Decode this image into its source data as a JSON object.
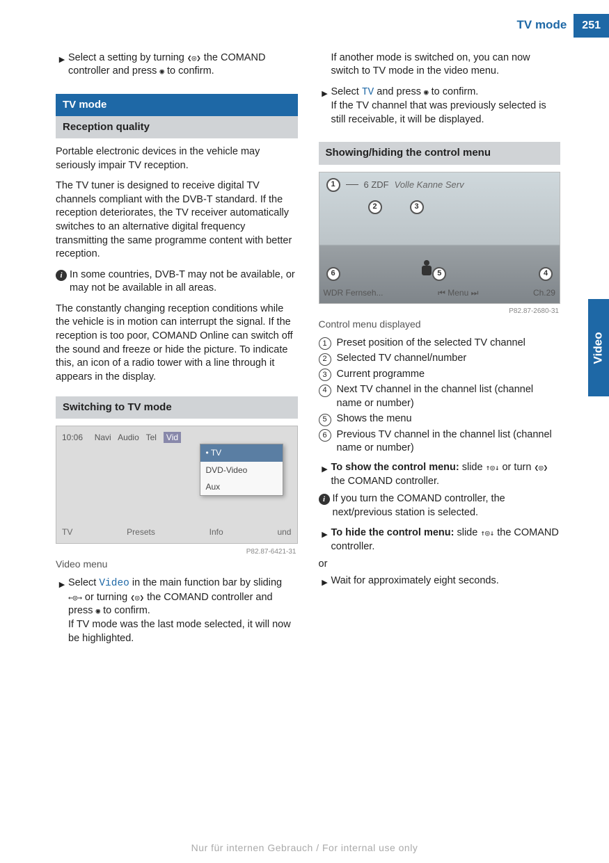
{
  "header": {
    "section": "TV mode",
    "page": "251"
  },
  "sideTab": "Video",
  "watermark": "Nur für internen Gebrauch / For internal use only",
  "left": {
    "topStep": {
      "prefix": "Select a setting by turning ",
      "icon": "❮◎❯",
      "mid": " the COMAND controller and press ",
      "press": "◉",
      "suffix": " to confirm."
    },
    "sectionTitle": "TV mode",
    "sub1": "Reception quality",
    "p1": "Portable electronic devices in the vehicle may seriously impair TV reception.",
    "p2": "The TV tuner is designed to receive digital TV channels compliant with the DVB-T standard. If the reception deteriorates, the TV receiver automatically switches to an alternative digital frequency transmitting the same programme content with better reception.",
    "info1": "In some countries, DVB-T may not be available, or may not be available in all areas.",
    "p3": "The constantly changing reception conditions while the vehicle is in motion can interrupt the signal. If the reception is too poor, COMAND Online can switch off the sound and freeze or hide the picture. To indicate this, an icon of a radio tower with a line through it appears in the display.",
    "sub2": "Switching to TV mode",
    "shot1": {
      "time": "10:06",
      "nav": "Navi",
      "audio": "Audio",
      "tel": "Tel",
      "vid": "Vid",
      "menu_tv": "• TV",
      "menu_dvd": "DVD-Video",
      "menu_aux": "Aux",
      "b_tv": "TV",
      "b_presets": "Presets",
      "b_info": "Info",
      "b_und": "und",
      "tag": "P82.87-6421-31"
    },
    "caption1": "Video menu",
    "step1": {
      "pre": "Select ",
      "term": "Video",
      "mid1": " in the main function bar by sliding ",
      "slide": "←◎→",
      "mid2": " or turning ",
      "turn": "❮◎❯",
      "mid3": " the COMAND controller and press ",
      "press": "◉",
      "mid4": " to confirm.",
      "tail": "If TV mode was the last mode selected, it will now be highlighted."
    }
  },
  "right": {
    "p1": "If another mode is switched on, you can now switch to TV mode in the video menu.",
    "step1": {
      "pre": "Select ",
      "term": "TV",
      "mid": " and press ",
      "press": "◉",
      "suf": " to confirm.",
      "tail": "If the TV channel that was previously selected is still receivable, it will be displayed."
    },
    "sub1": "Showing/hiding the control menu",
    "shot2": {
      "top_preset": "6 ZDF",
      "top_prog": "Volle Kanne Serv",
      "bl": "WDR Fernseh...",
      "prev": "⏮",
      "menu": "Menu",
      "next": "⏭",
      "ch": "Ch.29",
      "tag": "P82.87-2680-31"
    },
    "caption2": "Control menu displayed",
    "legend": {
      "l1": "Preset position of the selected TV channel",
      "l2": "Selected TV channel/number",
      "l3": "Current programme",
      "l4": "Next TV channel in the channel list (channel name or number)",
      "l5": "Shows the menu",
      "l6": "Previous TV channel in the channel list (channel name or number)"
    },
    "step2": {
      "bold": "To show the control menu:",
      "mid1": " slide ",
      "slide": "↑◎↓",
      "mid2": " or turn ",
      "turn": "❮◎❯",
      "mid3": " the COMAND controller."
    },
    "info2": "If you turn the COMAND controller, the next/previous station is selected.",
    "step3": {
      "bold": "To hide the control menu:",
      "mid1": " slide ",
      "slide": "↑◎↓",
      "mid2": " the COMAND controller."
    },
    "or": "or",
    "step4": "Wait for approximately eight seconds."
  }
}
